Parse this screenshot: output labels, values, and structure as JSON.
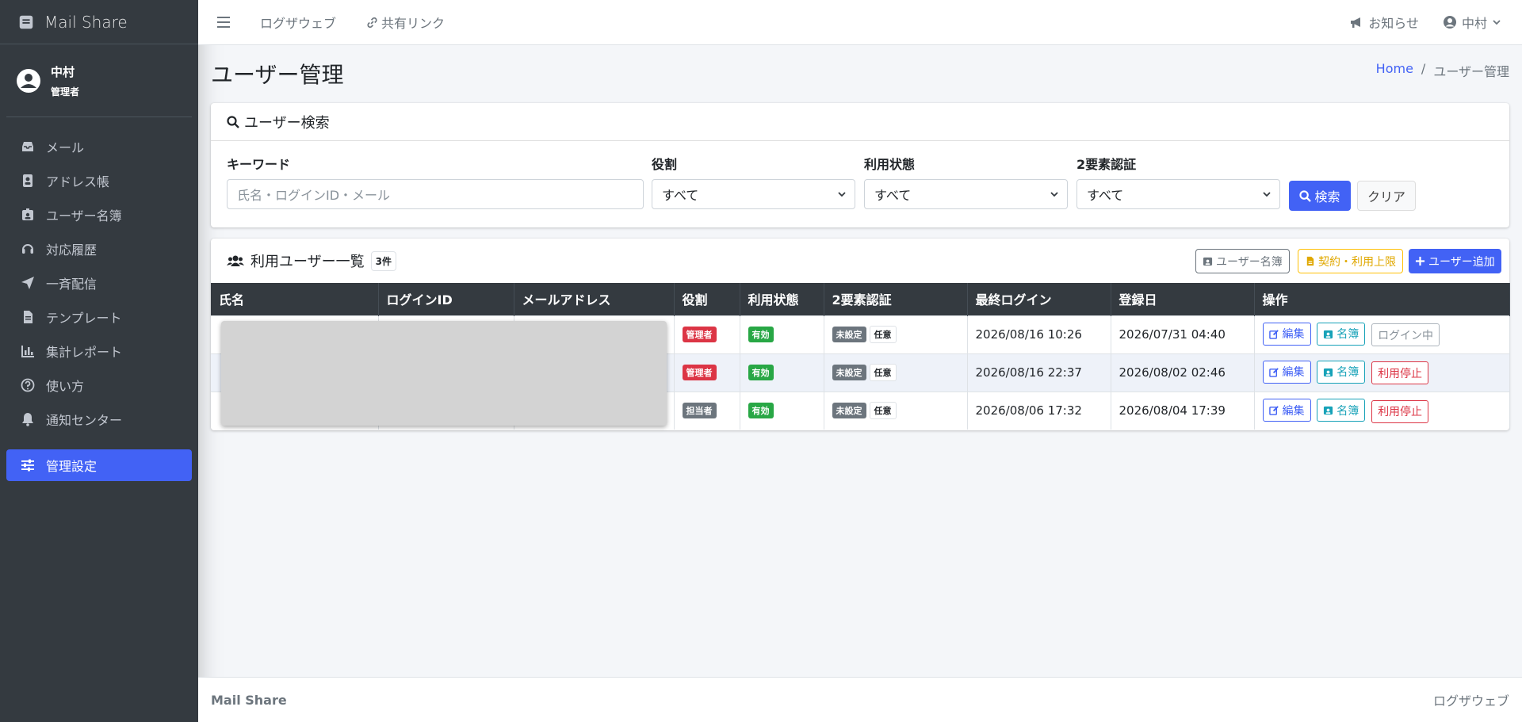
{
  "app": {
    "brand": "Mail Share"
  },
  "user": {
    "name": "中村",
    "role": "管理者"
  },
  "sidebar": {
    "items": [
      {
        "label": "メール",
        "icon": "inbox-icon"
      },
      {
        "label": "アドレス帳",
        "icon": "address-book-icon"
      },
      {
        "label": "ユーザー名簿",
        "icon": "id-badge-icon"
      },
      {
        "label": "対応履歴",
        "icon": "headset-icon"
      },
      {
        "label": "一斉配信",
        "icon": "paper-plane-icon"
      },
      {
        "label": "テンプレート",
        "icon": "file-icon"
      },
      {
        "label": "集計レポート",
        "icon": "bar-chart-icon"
      },
      {
        "label": "使い方",
        "icon": "question-circle-icon"
      },
      {
        "label": "通知センター",
        "icon": "bell-icon"
      },
      {
        "label": "管理設定",
        "icon": "sliders-icon",
        "active": true
      }
    ]
  },
  "topbar": {
    "link1": "ログザウェブ",
    "link2": "共有リンク",
    "notice": "お知らせ",
    "user": "中村"
  },
  "page": {
    "title": "ユーザー管理"
  },
  "breadcrumb": {
    "home": "Home",
    "sep": "/",
    "current": "ユーザー管理"
  },
  "search": {
    "title": "ユーザー検索",
    "keyword_label": "キーワード",
    "keyword_placeholder": "氏名・ログインID・メール",
    "role_label": "役割",
    "role_value": "すべて",
    "status_label": "利用状態",
    "status_value": "すべて",
    "twofa_label": "2要素認証",
    "twofa_value": "すべて",
    "search_button": "検索",
    "clear_button": "クリア"
  },
  "list": {
    "title": "利用ユーザー一覧",
    "count": "3件",
    "roster_button": "ユーザー名簿",
    "contract_button": "契約・利用上限",
    "add_button": "ユーザー追加",
    "columns": [
      "氏名",
      "ログインID",
      "メールアドレス",
      "役割",
      "利用状態",
      "2要素認証",
      "最終ログイン",
      "登録日",
      "操作"
    ],
    "rows": [
      {
        "role": "管理者",
        "role_color": "#dc3545",
        "status": "有効",
        "twofa": "未設定",
        "twofa_opt": "任意",
        "last_login": "2026/08/16 10:26",
        "registered": "2026/07/31 04:40",
        "edit": "編集",
        "roster": "名簿",
        "action3": "ログイン中",
        "action3_style": "gray"
      },
      {
        "role": "管理者",
        "role_color": "#dc3545",
        "status": "有効",
        "twofa": "未設定",
        "twofa_opt": "任意",
        "last_login": "2026/08/16 22:37",
        "registered": "2026/08/02 02:46",
        "edit": "編集",
        "roster": "名簿",
        "action3": "利用停止",
        "action3_style": "red"
      },
      {
        "role": "担当者",
        "role_color": "#6c757d",
        "status": "有効",
        "twofa": "未設定",
        "twofa_opt": "任意",
        "last_login": "2026/08/06 17:32",
        "registered": "2026/08/04 17:39",
        "edit": "編集",
        "roster": "名簿",
        "action3": "利用停止",
        "action3_style": "red"
      }
    ]
  },
  "footer": {
    "left": "Mail Share",
    "right": "ログザウェブ"
  }
}
